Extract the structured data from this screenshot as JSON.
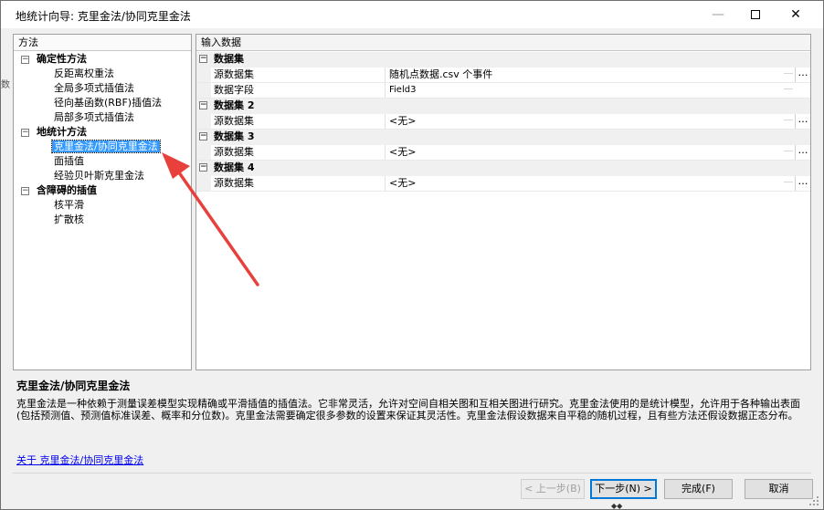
{
  "window": {
    "title": "地统计向导: 克里金法/协同克里金法",
    "minimize_glyph": "—",
    "close_glyph": "✕"
  },
  "left_panel": {
    "header": "方法",
    "groups": [
      {
        "label": "确定性方法",
        "items": [
          "反距离权重法",
          "全局多项式插值法",
          "径向基函数(RBF)插值法",
          "局部多项式插值法"
        ]
      },
      {
        "label": "地统计方法",
        "items": [
          "克里金法/协同克里金法",
          "面插值",
          "经验贝叶斯克里金法"
        ]
      },
      {
        "label": "含障碍的插值",
        "items": [
          "核平滑",
          "扩散核"
        ]
      }
    ],
    "toggle_glyph": "−",
    "selected_item": "克里金法/协同克里金法"
  },
  "right_panel": {
    "header": "输入数据",
    "ellipsis": "…",
    "categories": [
      {
        "label": "数据集",
        "props": [
          {
            "name": "源数据集",
            "value": "随机点数据.csv 个事件"
          },
          {
            "name": "数据字段",
            "value": "Field3"
          }
        ]
      },
      {
        "label": "数据集 2",
        "props": [
          {
            "name": "源数据集",
            "value": "<无>"
          }
        ]
      },
      {
        "label": "数据集 3",
        "props": [
          {
            "name": "源数据集",
            "value": "<无>"
          }
        ]
      },
      {
        "label": "数据集 4",
        "props": [
          {
            "name": "源数据集",
            "value": "<无>"
          }
        ]
      }
    ]
  },
  "description": {
    "title": "克里金法/协同克里金法",
    "text": "克里金法是一种依赖于测量误差模型实现精确或平滑插值的插值法。它非常灵活，允许对空间自相关图和互相关图进行研究。克里金法使用的是统计模型，允许用于各种输出表面(包括预测值、预测值标准误差、概率和分位数)。克里金法需要确定很多参数的设置来保证其灵活性。克里金法假设数据来自平稳的随机过程，且有些方法还假设数据正态分布。",
    "link": "关于 克里金法/协同克里金法"
  },
  "buttons": {
    "prev": "< 上一步(B)",
    "next": "下一步(N) >",
    "finish": "完成(F)",
    "cancel": "取消"
  },
  "edge_text": "数",
  "bottom_marks": "◆◆",
  "colors": {
    "selection": "#3399ff",
    "arrow": "#e8403a",
    "link": "#0000ee"
  }
}
